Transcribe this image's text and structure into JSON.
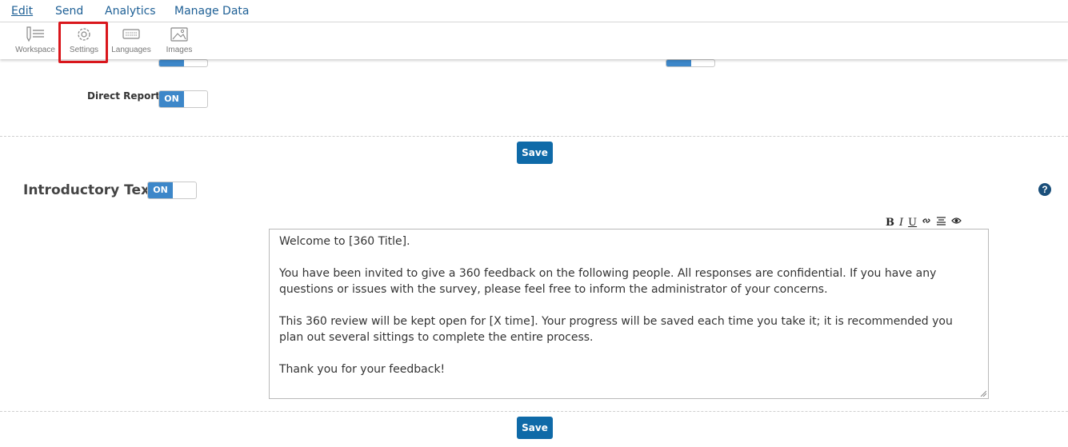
{
  "menu": {
    "items": [
      {
        "label": "Edit",
        "active": true
      },
      {
        "label": "Send",
        "active": false
      },
      {
        "label": "Analytics",
        "active": false
      },
      {
        "label": "Manage Data",
        "active": false
      }
    ]
  },
  "toolbar": {
    "workspace_label": "Workspace",
    "settings_label": "Settings",
    "languages_label": "Languages",
    "images_label": "Images"
  },
  "settings": {
    "direct_report_label": "Direct Report",
    "toggle_on_text": "ON",
    "save_label": "Save"
  },
  "intro": {
    "title": "Introductory Text",
    "toggle_on_text": "ON",
    "help_icon": "?",
    "tools": [
      "B",
      "I",
      "U",
      "link",
      "align",
      "eye"
    ],
    "paragraphs": [
      "Welcome to [360 Title].",
      "You have been invited to give a 360 feedback on the following people. All responses are confidential. If you have any questions or issues with the survey, please feel free to inform the administrator of your concerns.",
      "This 360 review will be kept open for [X time]. Your progress will be saved each time you take it; it is recommended you plan out several sittings to complete the entire process.",
      "Thank you for your feedback!"
    ],
    "save_label": "Save"
  },
  "colors": {
    "accent": "#0f6aa8",
    "toggle_on": "#3d87c9",
    "highlight": "#d9161c",
    "menu_link": "#1d5f95"
  }
}
